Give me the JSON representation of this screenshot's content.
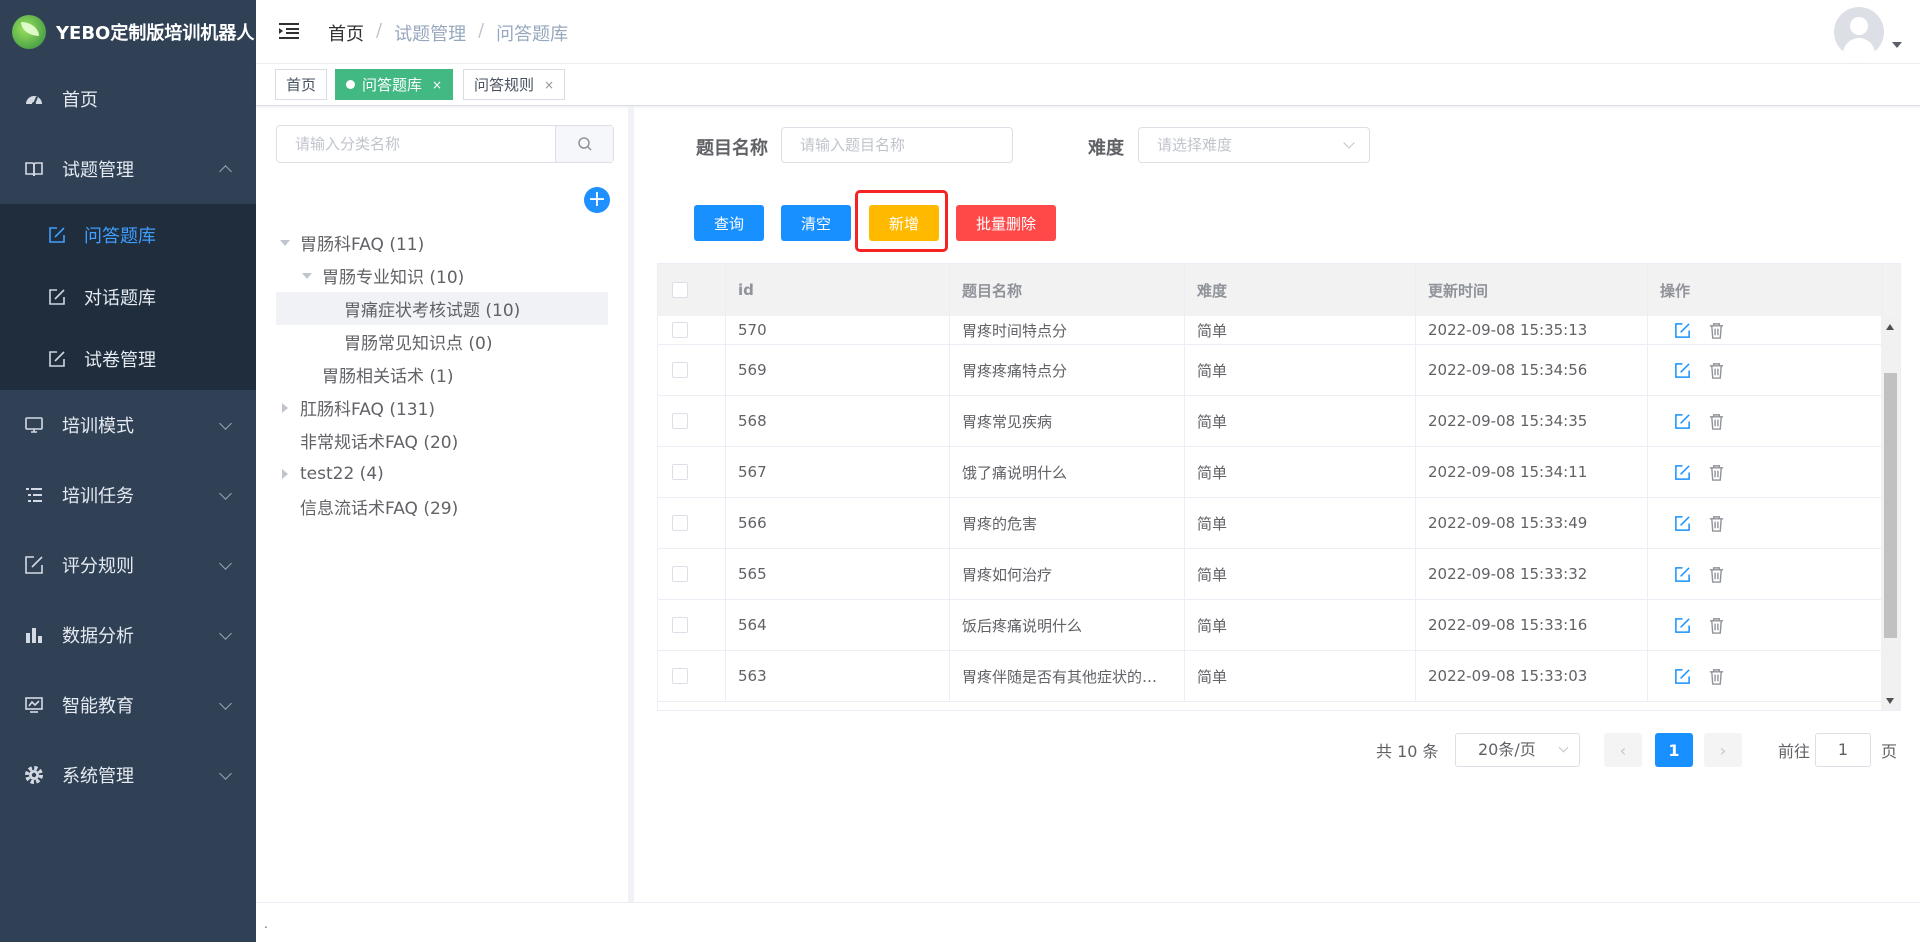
{
  "app": {
    "title": "YEBO定制版培训机器人"
  },
  "sidebar": {
    "items": [
      {
        "label": "首页",
        "icon": "dashboard-icon"
      },
      {
        "label": "试题管理",
        "icon": "book-icon",
        "open": true
      },
      {
        "label": "培训模式",
        "icon": "monitor-icon"
      },
      {
        "label": "培训任务",
        "icon": "list-icon"
      },
      {
        "label": "评分规则",
        "icon": "edit-icon"
      },
      {
        "label": "数据分析",
        "icon": "bar-chart-icon"
      },
      {
        "label": "智能教育",
        "icon": "screen-icon"
      },
      {
        "label": "系统管理",
        "icon": "gear-icon"
      }
    ],
    "sub_items": [
      {
        "label": "问答题库",
        "icon": "edit-icon",
        "active": true
      },
      {
        "label": "对话题库",
        "icon": "edit-icon"
      },
      {
        "label": "试卷管理",
        "icon": "edit-icon"
      }
    ]
  },
  "breadcrumb": {
    "items": [
      "首页",
      "试题管理",
      "问答题库"
    ],
    "separator": "/"
  },
  "tags": [
    {
      "label": "首页"
    },
    {
      "label": "问答题库",
      "active": true,
      "close": "×"
    },
    {
      "label": "问答规则",
      "close": "×"
    }
  ],
  "tree_panel": {
    "search_placeholder": "请输入分类名称",
    "add_symbol": "+",
    "nodes": [
      {
        "label": "胃肠科FAQ (11)",
        "level": 0,
        "caret": "down"
      },
      {
        "label": "胃肠专业知识 (10)",
        "level": 1,
        "caret": "down"
      },
      {
        "label": "胃痛症状考核试题 (10)",
        "level": 2,
        "caret": "none",
        "selected": true
      },
      {
        "label": "胃肠常见知识点 (0)",
        "level": 2,
        "caret": "none"
      },
      {
        "label": "胃肠相关话术 (1)",
        "level": 1,
        "caret": "none"
      },
      {
        "label": "肛肠科FAQ (131)",
        "level": 0,
        "caret": "right"
      },
      {
        "label": "非常规话术FAQ (20)",
        "level": 0,
        "caret": "none"
      },
      {
        "label": "test22 (4)",
        "level": 0,
        "caret": "right"
      },
      {
        "label": "信息流话术FAQ (29)",
        "level": 0,
        "caret": "none"
      }
    ]
  },
  "filters": {
    "name_label": "题目名称",
    "name_placeholder": "请输入题目名称",
    "difficulty_label": "难度",
    "difficulty_placeholder": "请选择难度"
  },
  "buttons": {
    "query": "查询",
    "clear": "清空",
    "add": "新增",
    "batch_delete": "批量删除"
  },
  "table": {
    "columns": [
      "id",
      "题目名称",
      "难度",
      "更新时间",
      "操作"
    ],
    "rows": [
      {
        "id": "570",
        "name": "胃疼时间特点分",
        "difficulty": "简单",
        "updated": "2022-09-08 15:35:13"
      },
      {
        "id": "569",
        "name": "胃疼疼痛特点分",
        "difficulty": "简单",
        "updated": "2022-09-08 15:34:56"
      },
      {
        "id": "568",
        "name": "胃疼常见疾病",
        "difficulty": "简单",
        "updated": "2022-09-08 15:34:35"
      },
      {
        "id": "567",
        "name": "饿了痛说明什么",
        "difficulty": "简单",
        "updated": "2022-09-08 15:34:11"
      },
      {
        "id": "566",
        "name": "胃疼的危害",
        "difficulty": "简单",
        "updated": "2022-09-08 15:33:49"
      },
      {
        "id": "565",
        "name": "胃疼如何治疗",
        "difficulty": "简单",
        "updated": "2022-09-08 15:33:32"
      },
      {
        "id": "564",
        "name": "饭后疼痛说明什么",
        "difficulty": "简单",
        "updated": "2022-09-08 15:33:16"
      },
      {
        "id": "563",
        "name": "胃疼伴随是否有其他症状的…",
        "difficulty": "简单",
        "updated": "2022-09-08 15:33:03"
      }
    ]
  },
  "pagination": {
    "total_text": "共 10 条",
    "page_size": "20条/页",
    "prev": "‹",
    "current_page": "1",
    "next": "›",
    "goto_prefix": "前往",
    "goto_value": "1",
    "goto_suffix": "页"
  },
  "footer": {
    "text": "."
  },
  "colors": {
    "sidebar_bg": "#304156",
    "submenu_bg": "#1f2d3d",
    "primary": "#1890ff",
    "tag_active": "#42b983",
    "add_button": "#ffba00",
    "delete_button": "#ff4949",
    "highlight_box": "#f42424"
  }
}
